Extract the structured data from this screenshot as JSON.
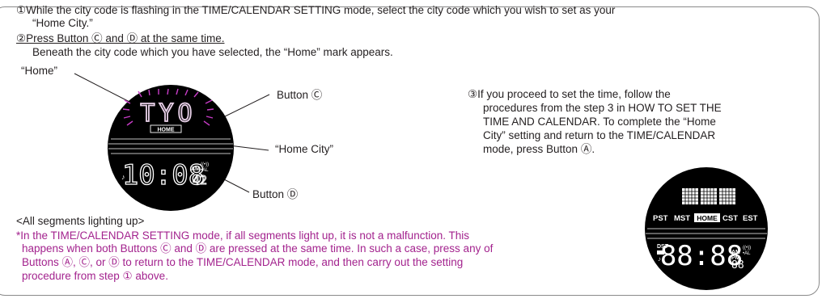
{
  "instructions": {
    "step1_line1": "①While the city code is flashing in the TIME/CALENDAR SETTING mode, select the city code which you wish to set as your",
    "step1_line2": "“Home City.”",
    "step2_line1": "②Press Button Ⓒ and Ⓓ at the same time.",
    "step2_line2": "Beneath the city code which you have selected, the “Home” mark appears.",
    "step3_line1": "③If you proceed to set the time, follow the",
    "step3_line2": "procedures from the step 3 in HOW TO SET THE",
    "step3_line3": "TIME AND CALENDAR. To complete the “Home",
    "step3_line4": "City” setting and return to the TIME/CALENDAR",
    "step3_line5": "mode, press Button Ⓐ."
  },
  "callouts": {
    "home": "“Home”",
    "button_c": "Button Ⓒ",
    "home_city": "“Home City”",
    "button_d": "Button Ⓓ"
  },
  "watch1": {
    "city_code": "TYO",
    "home_mark": "HOME",
    "time": "10:08",
    "seconds": "42",
    "am": "AM",
    "alarm_signal": "((•))",
    "alarm": "•AL"
  },
  "watch2": {
    "cities": [
      "PST",
      "MST",
      "HOME",
      "CST",
      "EST"
    ],
    "dst": "DST",
    "time": "88:88",
    "seconds": "88",
    "am": "AM",
    "pm": "PM",
    "alarm_signal": "((•))",
    "alarm": "•AL"
  },
  "note": {
    "heading": "<All segments lighting up>",
    "line1": "*In the TIME/CALENDAR SETTING mode, if all segments light up, it is not a malfunction. This",
    "line2": "happens when both Buttons Ⓒ and Ⓓ are pressed at the same time.  In such a case, press any of",
    "line3": "Buttons Ⓐ, Ⓒ, or Ⓓ to return to the TIME/CALENDAR mode, and then carry out the setting",
    "line4": "procedure from step ① above."
  },
  "colors": {
    "text": "#231f20",
    "accent": "#a3238e",
    "lcd": "#000000",
    "flash": "#c83cc8"
  }
}
